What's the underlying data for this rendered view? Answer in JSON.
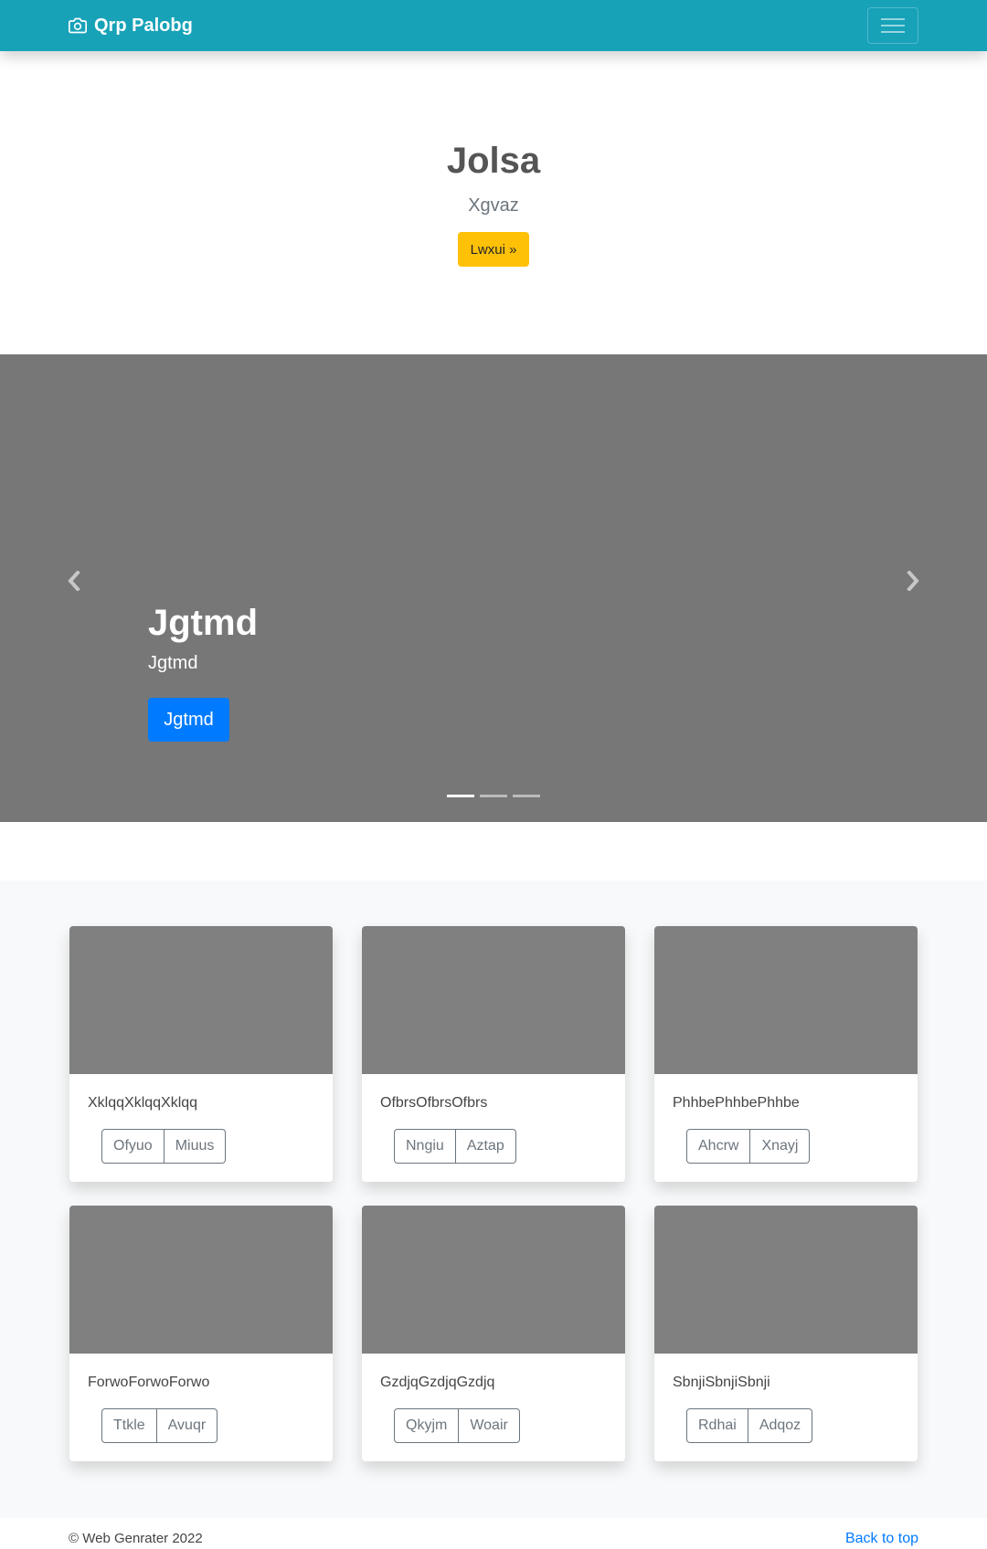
{
  "navbar": {
    "brand": "Qrp Palobg",
    "brand_icon": "camera-icon",
    "toggler_icon": "hamburger-menu-icon",
    "background": "#17a2b8"
  },
  "hero": {
    "title": "Jolsa",
    "subtitle": "Xgvaz",
    "button_label": "Lwxui »",
    "button_color": "#ffc107"
  },
  "carousel": {
    "title": "Jgtmd",
    "text": "Jgtmd",
    "button_label": "Jgtmd",
    "button_color": "#007bff",
    "prev_icon": "chevron-left-icon",
    "next_icon": "chevron-right-icon",
    "slide_count": 3,
    "active_slide": 1
  },
  "cards": [
    {
      "text": "XklqqXklqqXklqq",
      "buttons": [
        "Ofyuo",
        "Miuus"
      ]
    },
    {
      "text": "OfbrsOfbrsOfbrs",
      "buttons": [
        "Nngiu",
        "Aztap"
      ]
    },
    {
      "text": "PhhbePhhbePhhbe",
      "buttons": [
        "Ahcrw",
        "Xnayj"
      ]
    },
    {
      "text": "ForwoForwoForwo",
      "buttons": [
        "Ttkle",
        "Avuqr"
      ]
    },
    {
      "text": "GzdjqGzdjqGzdjq",
      "buttons": [
        "Qkyjm",
        "Woair"
      ]
    },
    {
      "text": "SbnjiSbnjiSbnji",
      "buttons": [
        "Rdhai",
        "Adqoz"
      ]
    }
  ],
  "footer": {
    "copyright": "© Web Genrater 2022",
    "back_to_top": "Back to top"
  }
}
